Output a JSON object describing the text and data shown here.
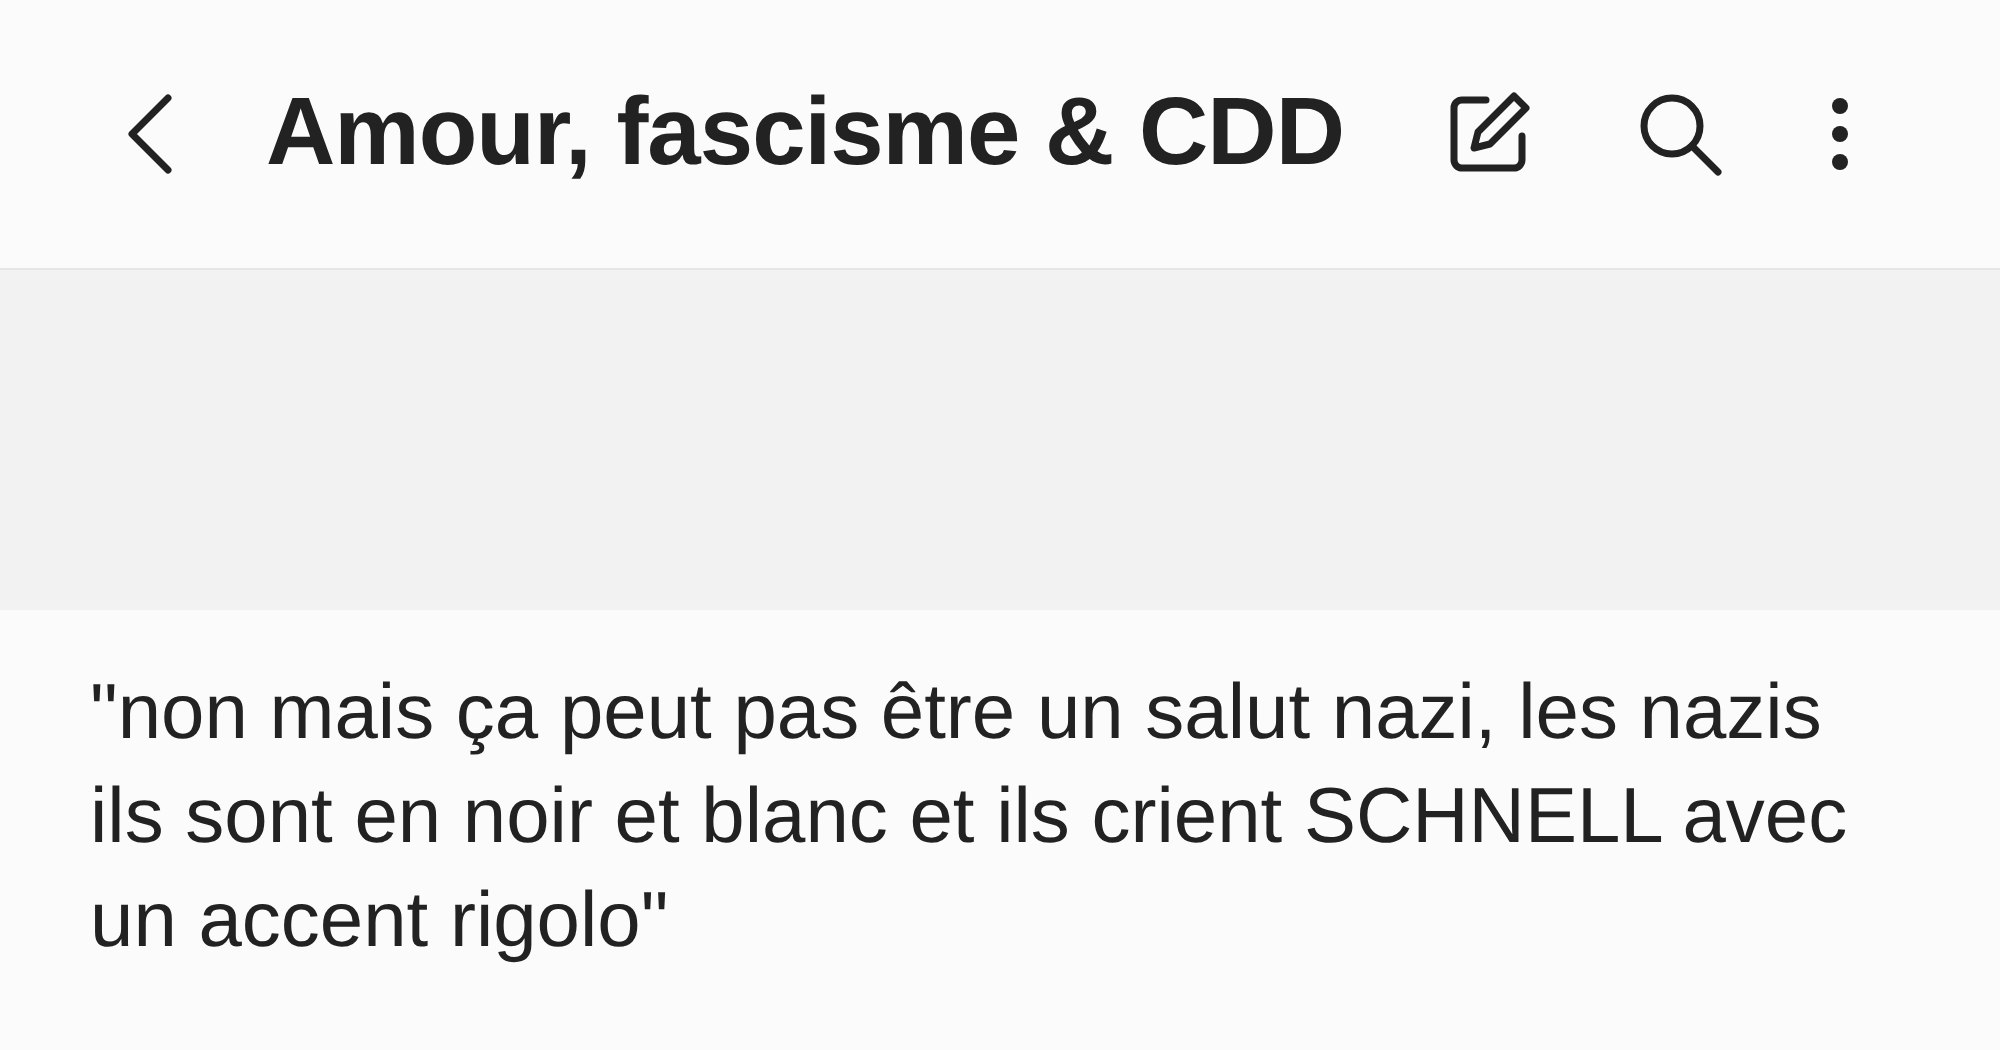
{
  "header": {
    "title": "Amour, fascisme & CDD"
  },
  "note": {
    "text": "\"non mais ça peut pas être un salut nazi, les nazis ils sont en noir et blanc et ils crient SCHNELL avec un accent rigolo\""
  }
}
